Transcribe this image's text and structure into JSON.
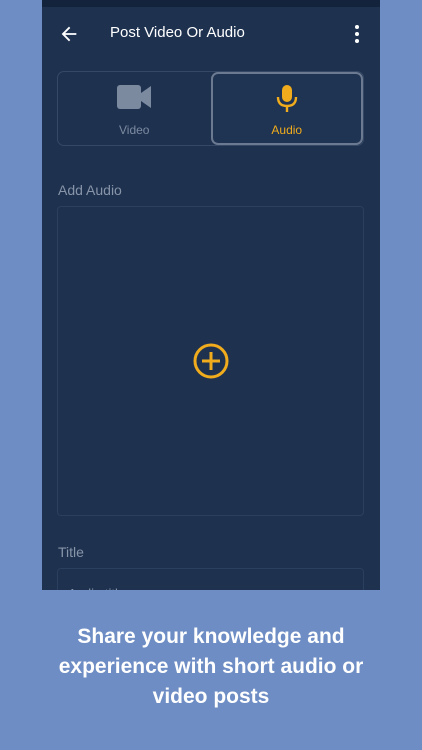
{
  "app_bar": {
    "title": "Post Video Or Audio",
    "back_icon": "arrow-left-icon",
    "menu_icon": "more-vert-icon"
  },
  "tabs": [
    {
      "label": "Video",
      "icon": "videocam-icon",
      "active": false
    },
    {
      "label": "Audio",
      "icon": "mic-icon",
      "active": true
    }
  ],
  "add_audio": {
    "label": "Add Audio",
    "icon": "add-circle-icon"
  },
  "title_field": {
    "label": "Title",
    "placeholder": "Audio title"
  },
  "caption": {
    "line1": "Share your knowledge and",
    "line2": "experience with short audio or",
    "line3": "video posts"
  },
  "colors": {
    "background": "#6d8dc4",
    "screen": "#1e3250",
    "accent": "#f0ac1c",
    "muted": "#7c8aa0"
  }
}
